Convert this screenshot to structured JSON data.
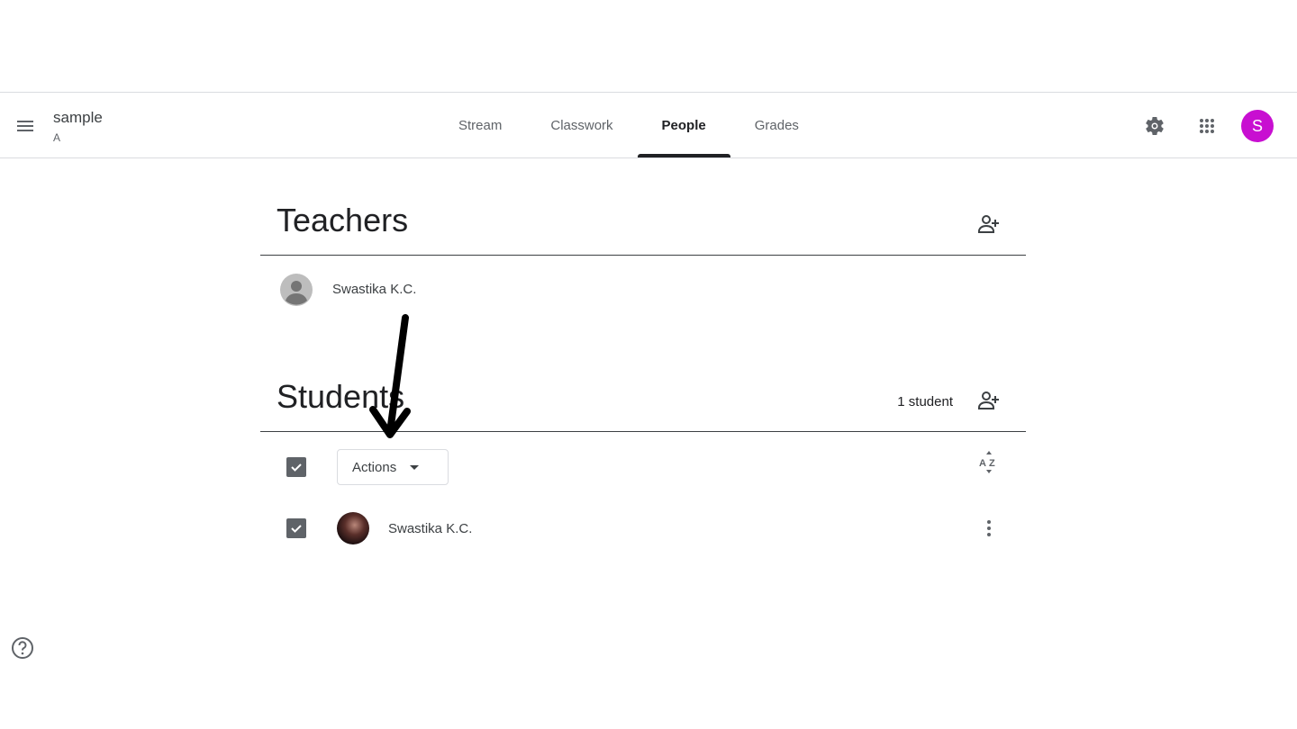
{
  "header": {
    "class_title": "sample",
    "class_section": "A",
    "tabs": [
      {
        "label": "Stream"
      },
      {
        "label": "Classwork"
      },
      {
        "label": "People"
      },
      {
        "label": "Grades"
      }
    ],
    "active_tab": "People",
    "user_initial": "S",
    "avatar_color": "#c80fd1"
  },
  "teachers": {
    "title": "Teachers",
    "list": [
      {
        "name": "Swastika K.C."
      }
    ]
  },
  "students": {
    "title": "Students",
    "count_label": "1 student",
    "actions_label": "Actions",
    "list": [
      {
        "name": "Swastika K.C.",
        "checked": true
      }
    ]
  },
  "icons": {
    "menu": "menu-icon",
    "settings": "gear-icon",
    "apps": "apps-grid-icon",
    "invite": "add-person-icon",
    "sort": "sort-az-icon",
    "more": "more-vert-icon",
    "help": "help-icon"
  }
}
